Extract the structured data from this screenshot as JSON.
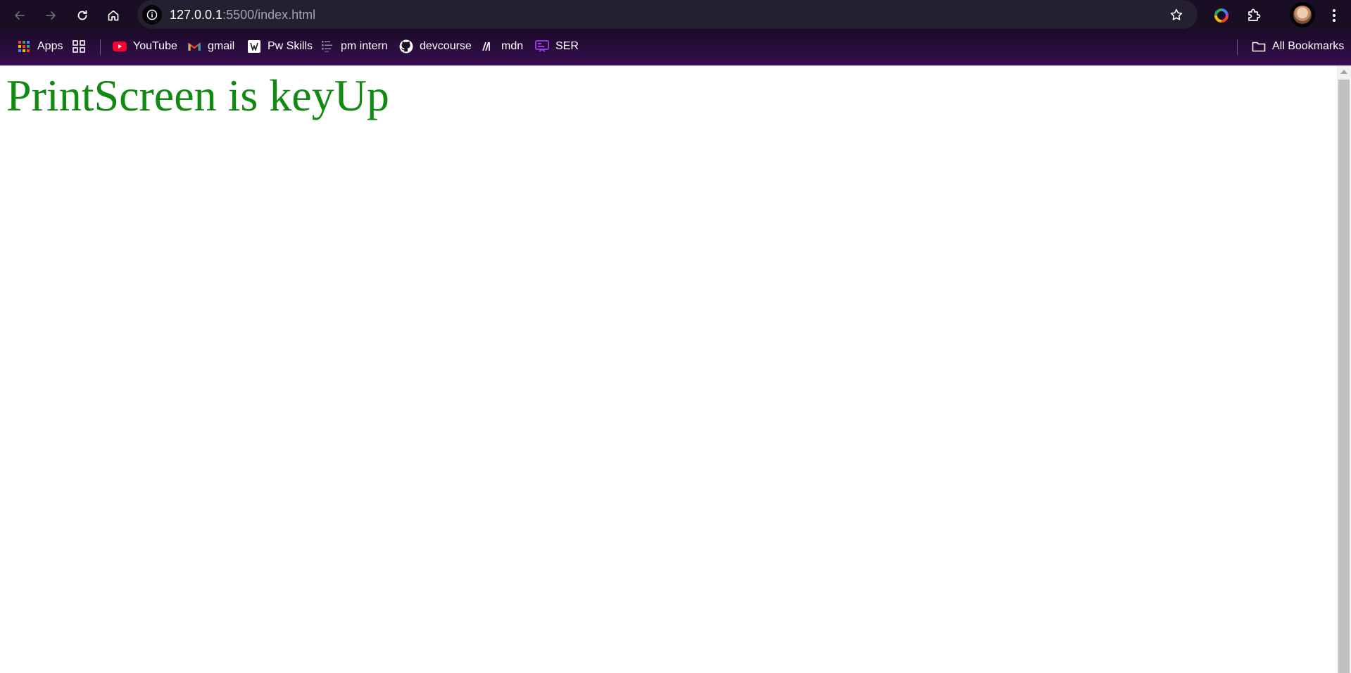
{
  "browser": {
    "url_host": "127.0.0.1",
    "url_rest": ":5500/index.html"
  },
  "bookmarks": {
    "items": [
      {
        "label": "Apps",
        "icon": "apps-grid-icon"
      },
      {
        "label": "YouTube",
        "icon": "youtube-icon"
      },
      {
        "label": "gmail",
        "icon": "gmail-icon"
      },
      {
        "label": "Pw Skills",
        "icon": "pw-skills-icon"
      },
      {
        "label": "pm intern",
        "icon": "pm-intern-icon"
      },
      {
        "label": "devcourse",
        "icon": "github-icon"
      },
      {
        "label": "mdn",
        "icon": "mdn-icon"
      },
      {
        "label": "SER",
        "icon": "ser-icon"
      }
    ],
    "all_bookmarks": "All Bookmarks"
  },
  "page": {
    "heading": "PrintScreen is keyUp",
    "heading_color": "#118a11"
  }
}
